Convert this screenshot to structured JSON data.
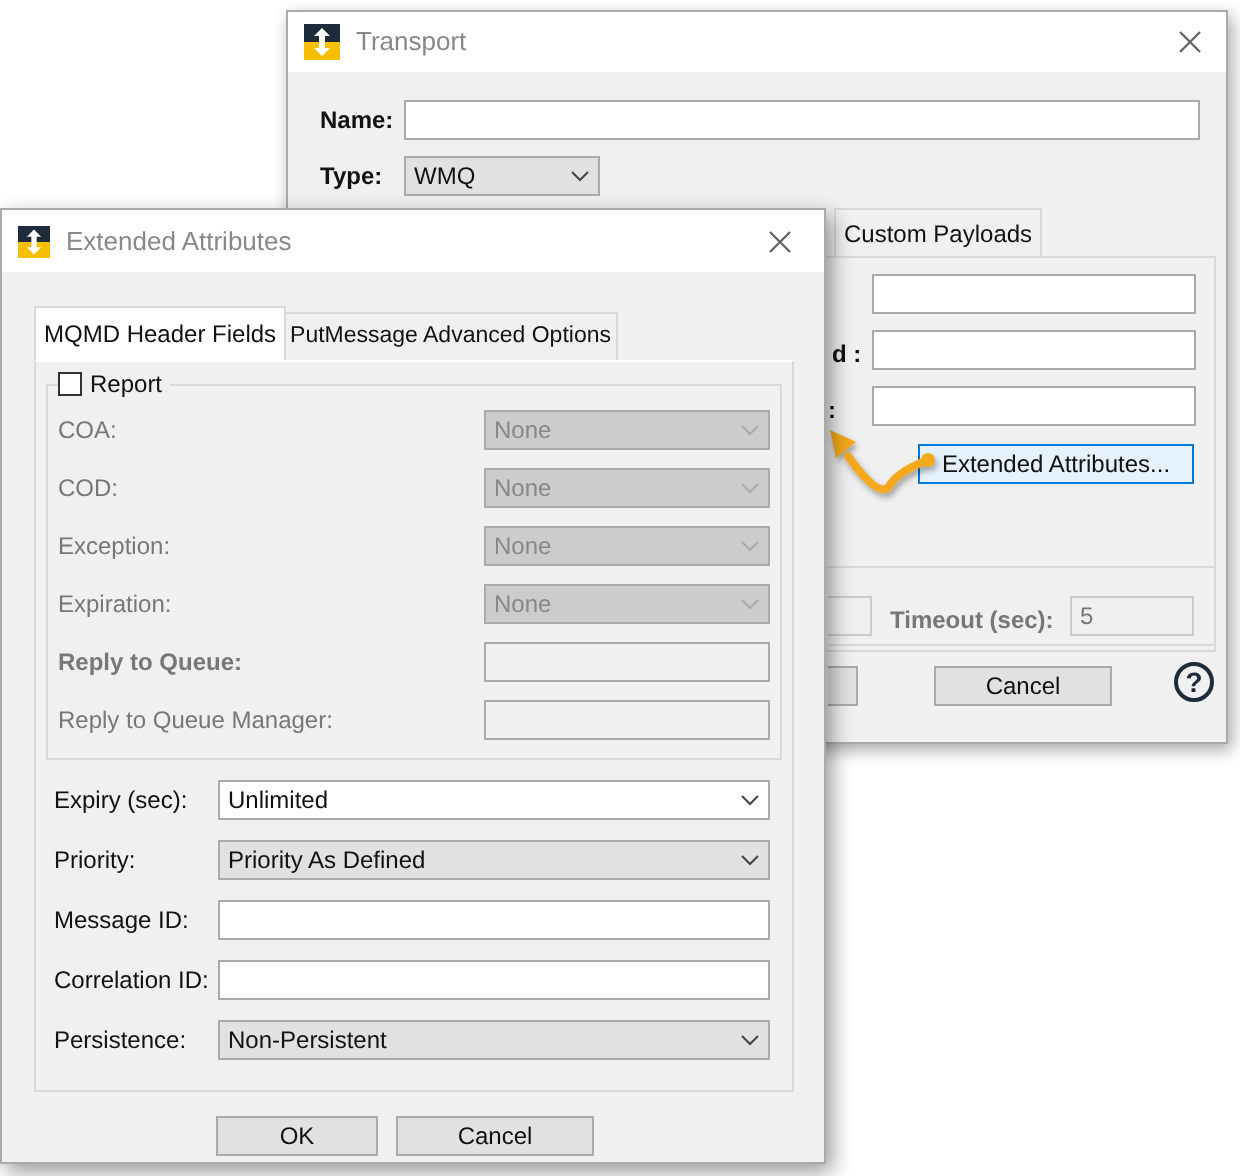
{
  "transport_window": {
    "title": "Transport",
    "name_label": "Name:",
    "type_label": "Type:",
    "type_value": "WMQ",
    "tabs": [
      {
        "label": "Custom Payloads",
        "selected": false
      }
    ],
    "partial_labels": [
      "d :",
      ":"
    ],
    "extended_button": "Extended Attributes...",
    "timeout_label": "Timeout (sec):",
    "timeout_value": "5",
    "cancel_button": "Cancel",
    "help": "?"
  },
  "extended_window": {
    "title": "Extended Attributes",
    "tabs": [
      {
        "label": "MQMD Header Fields",
        "selected": true
      },
      {
        "label": "PutMessage Advanced Options",
        "selected": false
      }
    ],
    "report": {
      "label": "Report",
      "checked": false
    },
    "report_fields": [
      {
        "label": "COA:",
        "kind": "dropdown",
        "value": "None",
        "disabled": true,
        "bold": false
      },
      {
        "label": "COD:",
        "kind": "dropdown",
        "value": "None",
        "disabled": true,
        "bold": false
      },
      {
        "label": "Exception:",
        "kind": "dropdown",
        "value": "None",
        "disabled": true,
        "bold": false
      },
      {
        "label": "Expiration:",
        "kind": "dropdown",
        "value": "None",
        "disabled": true,
        "bold": false
      },
      {
        "label": "Reply to Queue:",
        "kind": "text",
        "disabled": true,
        "bold": true
      },
      {
        "label": "Reply to Queue Manager:",
        "kind": "text",
        "disabled": true,
        "bold": false
      }
    ],
    "fields": [
      {
        "label": "Expiry (sec):",
        "kind": "combo",
        "value": "Unlimited"
      },
      {
        "label": "Priority:",
        "kind": "dropdown",
        "value": "Priority As Defined"
      },
      {
        "label": "Message ID:",
        "kind": "text"
      },
      {
        "label": "Correlation ID:",
        "kind": "text"
      },
      {
        "label": "Persistence:",
        "kind": "dropdown",
        "value": "Non-Persistent"
      }
    ],
    "buttons": [
      "OK",
      "Cancel"
    ]
  }
}
